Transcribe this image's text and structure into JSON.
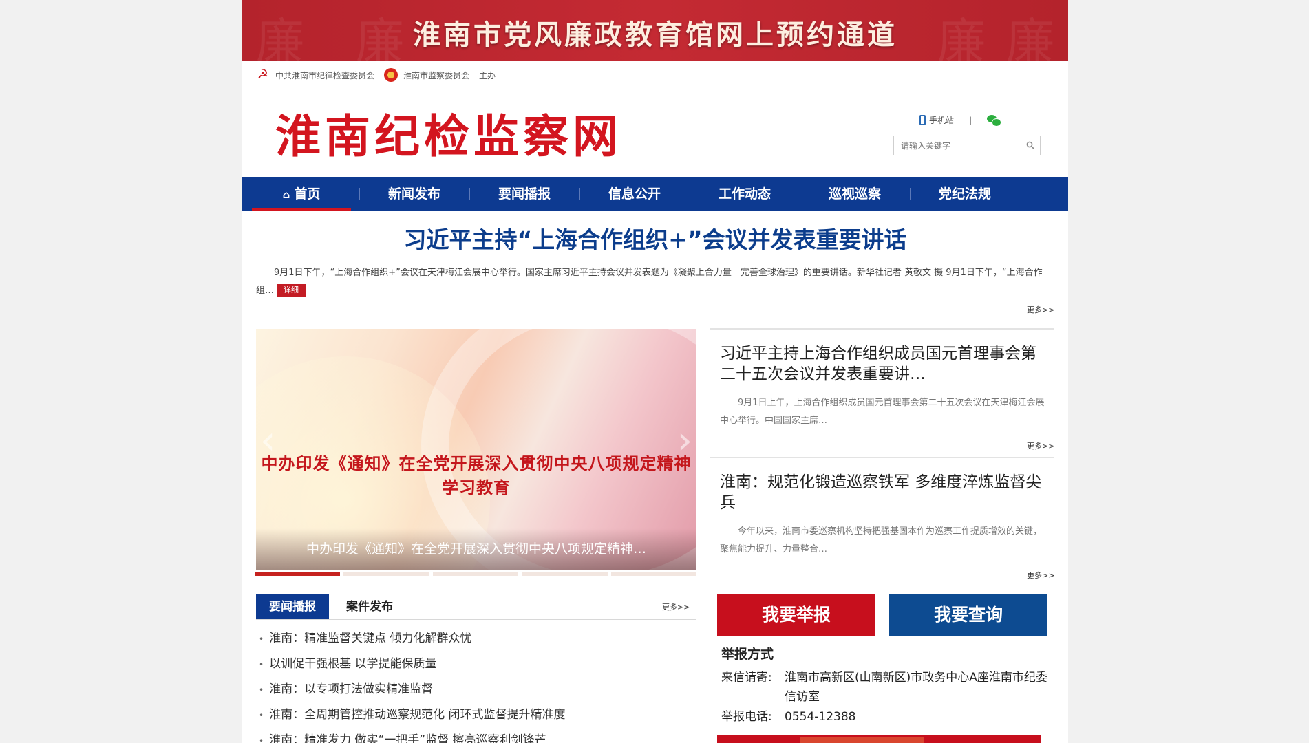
{
  "banner": {
    "title": "淮南市党风廉政教育馆网上预约通道",
    "watermark_chars": [
      "廉",
      "廉",
      "廉",
      "廉"
    ]
  },
  "hosts": {
    "org1": "中共淮南市纪律检查委员会",
    "org2": "淮南市监察委员会",
    "suffix": "主办"
  },
  "header": {
    "logo": "淮南纪检监察网",
    "mobile_label": "手机站",
    "separator": "|",
    "search_placeholder": "请输入关键字"
  },
  "nav": {
    "items": [
      {
        "label": "首页"
      },
      {
        "label": "新闻发布"
      },
      {
        "label": "要闻播报"
      },
      {
        "label": "信息公开"
      },
      {
        "label": "工作动态"
      },
      {
        "label": "巡视巡察"
      },
      {
        "label": "党纪法规"
      }
    ],
    "active_index": 0
  },
  "headline": {
    "title": "习近平主持“上海合作组织+”会议并发表重要讲话",
    "summary": "9月1日下午，“上海合作组织+”会议在天津梅江会展中心举行。国家主席习近平主持会议并发表题为《凝聚上合力量　完善全球治理》的重要讲话。新华社记者 黄敬文 摄 9月1日下午，“上海合作组…",
    "detail_label": "详细",
    "more_label": "更多>>"
  },
  "slider": {
    "image_text": "中办印发《通知》在全党开展深入贯彻中央八项规定精神学习教育",
    "caption": "中办印发《通知》在全党开展深入贯彻中央八项规定精神…",
    "prev": "‹",
    "next": "›",
    "slide_count": 5,
    "active_slide": 0
  },
  "right_news": [
    {
      "title": "习近平主持上海合作组织成员国元首理事会第二十五次会议并发表重要讲…",
      "summary": "9月1日上午，上海合作组织成员国元首理事会第二十五次会议在天津梅江会展中心举行。中国国家主席…",
      "more": "更多>>"
    },
    {
      "title": "淮南：规范化锻造巡察铁军 多维度淬炼监督尖兵",
      "summary": "今年以来，淮南市委巡察机构坚持把强基固本作为巡察工作提质增效的关键，聚焦能力提升、力量整合…",
      "more": "更多>>"
    }
  ],
  "tabs": {
    "items": [
      {
        "label": "要闻播报"
      },
      {
        "label": "案件发布"
      }
    ],
    "active_index": 0,
    "more": "更多>>"
  },
  "news_list": [
    "淮南：精准监督关键点 倾力化解群众忧",
    "以训促干强根基 以学提能保质量",
    "淮南：以专项打法做实精准监督",
    "淮南：全周期管控推动巡察规范化 闭环式监督提升精准度",
    "淮南：精准发力 做实“一把手”监督 擦亮巡察利剑锋芒"
  ],
  "report": {
    "report_button": "我要举报",
    "query_button": "我要查询",
    "title": "举报方式",
    "letter_label": "来信请寄:",
    "letter_value": "淮南市高新区(山南新区)市政务中心A座淮南市纪委信访室",
    "phone_label": "举报电话:",
    "phone_value": "0554-12388"
  },
  "colors": {
    "brand_red": "#c70f1d",
    "nav_blue": "#0d3a91",
    "headline_blue": "#0c3d8c"
  }
}
